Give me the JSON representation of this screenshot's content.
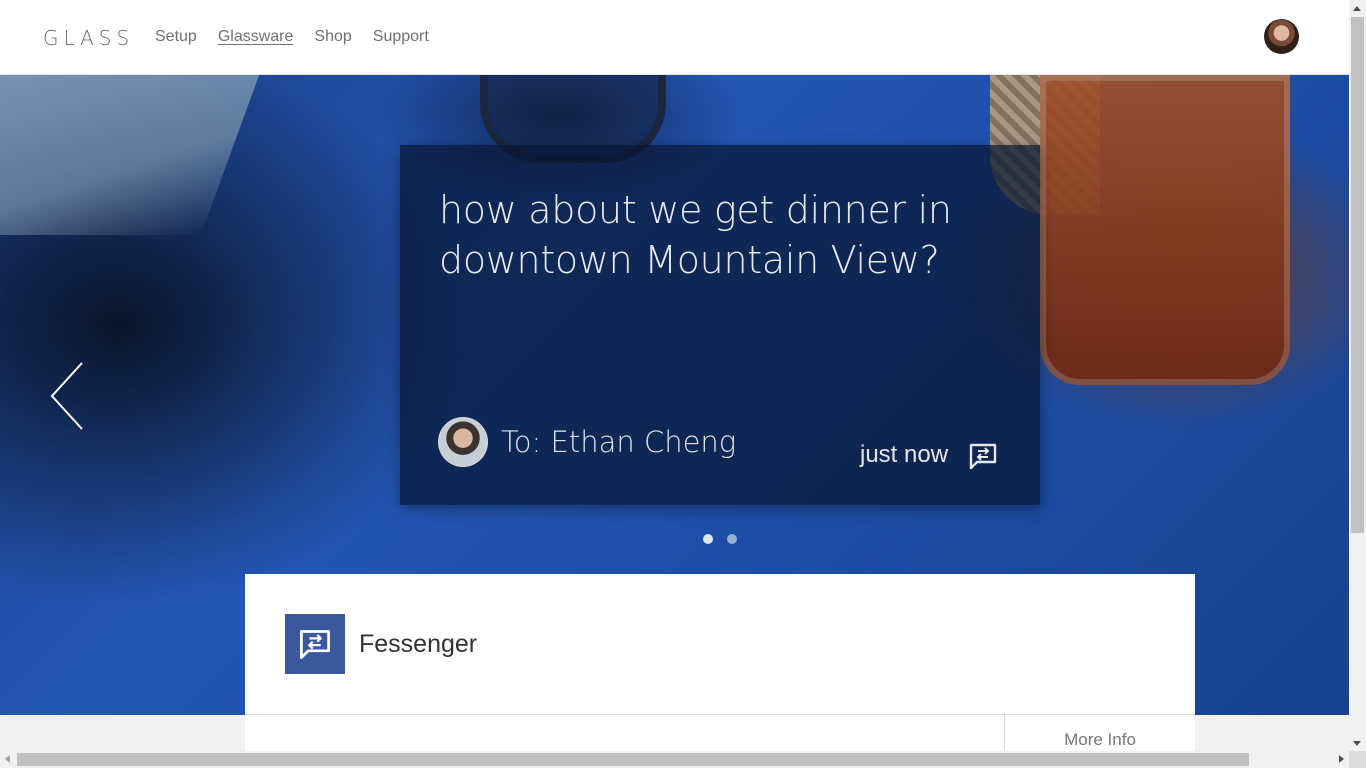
{
  "header": {
    "logo": "GLASS",
    "nav": [
      {
        "label": "Setup",
        "active": false
      },
      {
        "label": "Glassware",
        "active": true
      },
      {
        "label": "Shop",
        "active": false
      },
      {
        "label": "Support",
        "active": false
      }
    ],
    "avatar_icon": "user-avatar"
  },
  "hero": {
    "prev_icon": "chevron-left-icon",
    "card": {
      "message": "how about we get dinner in downtown Mountain View?",
      "recipient": "To: Ethan Cheng",
      "time": "just now",
      "chat_icon": "chat-swap-icon"
    },
    "carousel": {
      "total": 2,
      "active_index": 0
    }
  },
  "app": {
    "name": "Fessenger",
    "icon": "chat-swap-icon",
    "icon_color": "#3b579d",
    "more_info": "More Info"
  },
  "colors": {
    "card_background": "#081632",
    "accent": "#3b579d"
  }
}
